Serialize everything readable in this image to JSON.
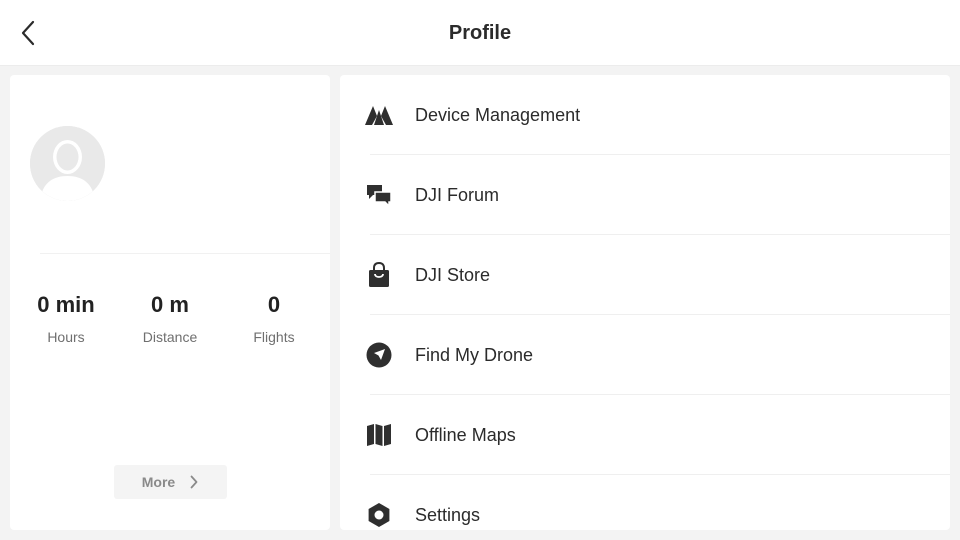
{
  "header": {
    "title": "Profile",
    "back_icon": "chevron-left-icon"
  },
  "profile": {
    "avatar_icon": "default-avatar-icon",
    "stats": [
      {
        "value": "0 min",
        "label": "Hours"
      },
      {
        "value": "0 m",
        "label": "Distance"
      },
      {
        "value": "0",
        "label": "Flights"
      }
    ],
    "more_label": "More",
    "more_icon": "chevron-right-icon"
  },
  "menu": {
    "items": [
      {
        "label": "Device Management",
        "icon": "drone-device-icon"
      },
      {
        "label": "DJI Forum",
        "icon": "chat-bubbles-icon"
      },
      {
        "label": "DJI Store",
        "icon": "shopping-bag-icon"
      },
      {
        "label": "Find My Drone",
        "icon": "compass-icon"
      },
      {
        "label": "Offline Maps",
        "icon": "map-icon"
      },
      {
        "label": "Settings",
        "icon": "settings-hexagon-icon"
      }
    ]
  },
  "colors": {
    "background": "#f3f3f3",
    "card": "#ffffff",
    "text": "#2b2b2b",
    "muted_text": "#6f6f6f",
    "icon": "#2f2f2f",
    "avatar_bg": "#e9e9e9"
  }
}
